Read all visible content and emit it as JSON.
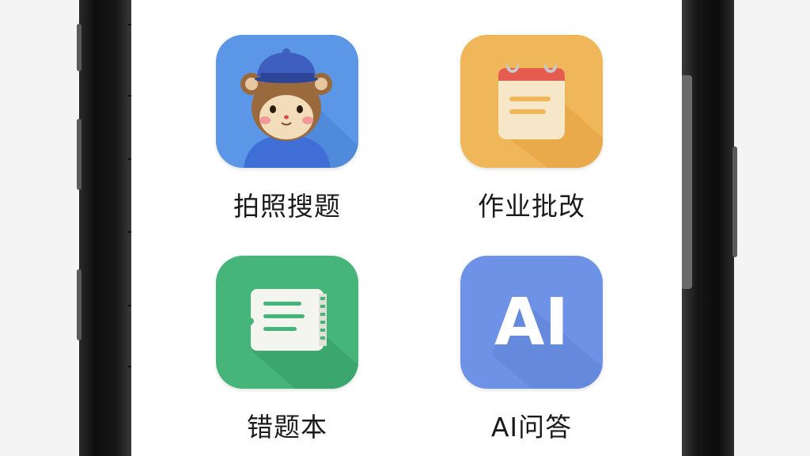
{
  "apps": [
    {
      "label": "拍照搜题",
      "icon": "monkey-mascot-icon",
      "color": "#5b97e6"
    },
    {
      "label": "作业批改",
      "icon": "notepad-icon",
      "color": "#f0b75a"
    },
    {
      "label": "错题本",
      "icon": "notebook-icon",
      "color": "#46b57a"
    },
    {
      "label": "AI问答",
      "icon": "ai-text-icon",
      "color": "#6e93e6"
    }
  ],
  "ai_icon_text": "AI"
}
